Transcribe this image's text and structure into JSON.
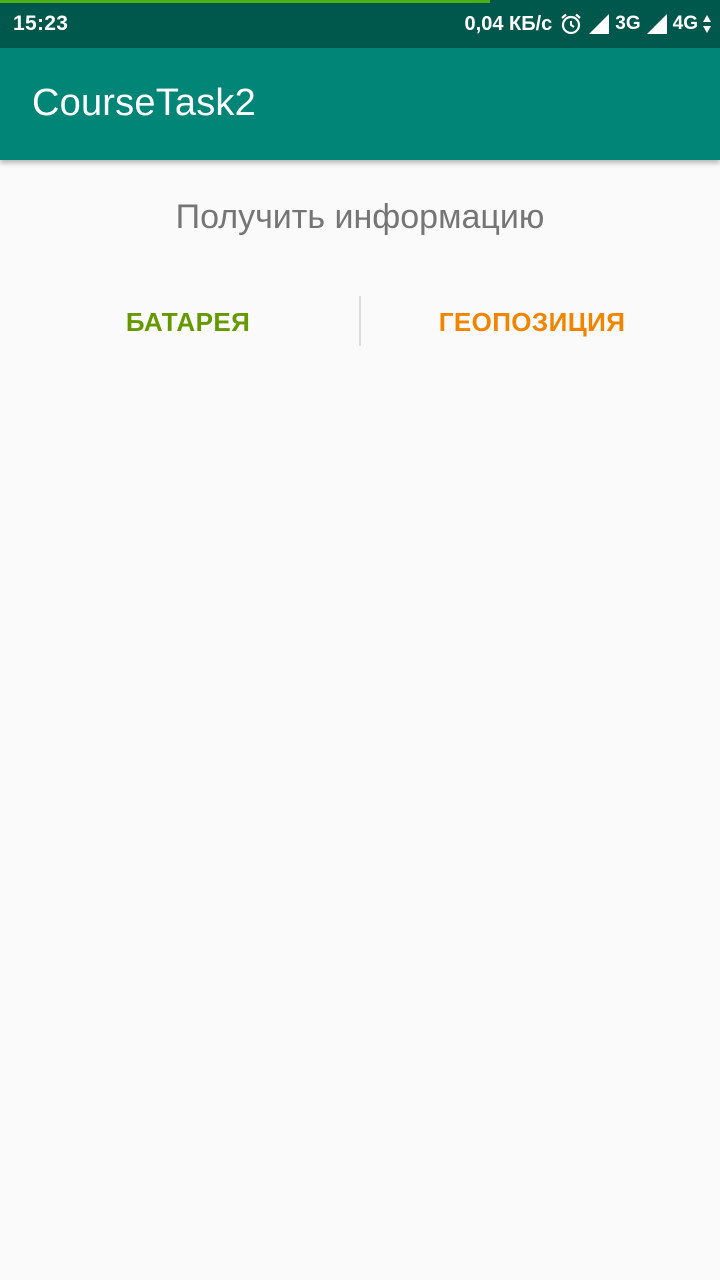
{
  "status_bar": {
    "time": "15:23",
    "speed": "0,04 КБ/с",
    "alarm_icon": "alarm-clock-icon",
    "signal_icon": "signal-triangle-icon",
    "network_1": "3G",
    "network_2": "4G",
    "data_arrows_icon": "up-down-arrows-icon",
    "load_progress": 0.68
  },
  "app_bar": {
    "title": "CourseTask2"
  },
  "main": {
    "heading": "Получить информацию",
    "battery_button": "БАТАРЕЯ",
    "geo_button": "ГЕОПОЗИЦИЯ"
  },
  "colors": {
    "status_bar": "#00574b",
    "app_bar": "#008577",
    "battery_text": "#669900",
    "geo_text": "#f28500",
    "background": "#fafafa"
  }
}
